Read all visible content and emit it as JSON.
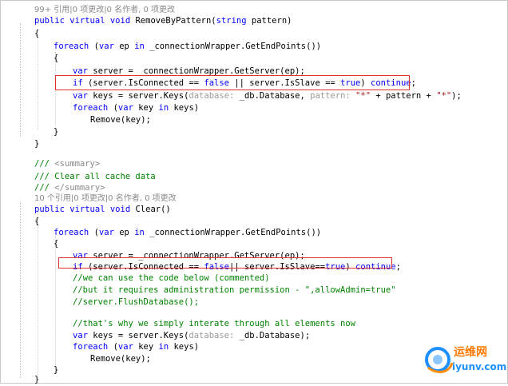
{
  "block1": {
    "lens": "99+ 引用|0 项更改|0 名作者, 0 项更改",
    "sig": {
      "kw1": "public",
      "kw2": "virtual",
      "kw3": "void",
      "name": " RemoveByPattern(",
      "kw4": "string",
      "tail": " pattern)"
    },
    "open1": "{",
    "foreach": {
      "kw": "foreach",
      "a": " (",
      "kw2": "var",
      "b": " ep ",
      "kw3": "in",
      "c": " _connectionWrapper.GetEndPoints())"
    },
    "open2": "{",
    "server": {
      "kw": "var",
      "rest": " server = _connectionWrapper.GetServer(ep);"
    },
    "ifline": {
      "kw": "if",
      "a": " (server.IsConnected == ",
      "kw2": "false",
      "b": " || server.IsSlave == ",
      "kw3": "true",
      "c": ") ",
      "kw4": "continue",
      "d": ";"
    },
    "keys": {
      "kw": "var",
      "a": " keys = server.Keys(",
      "h1": "database:",
      "b": " _db.Database, ",
      "h2": "pattern:",
      "c": " ",
      "s1": "\"*\"",
      "d": " + pattern + ",
      "s2": "\"*\"",
      "e": ");"
    },
    "foreach2": {
      "kw": "foreach",
      "a": " (",
      "kw2": "var",
      "b": " key ",
      "kw3": "in",
      "c": " keys)"
    },
    "remove": "Remove(key);",
    "close2": "}",
    "close1": "}"
  },
  "block2": {
    "sum1": "/// ",
    "sum1tag": "<summary>",
    "sum2": "/// Clear all cache data",
    "sum3": "/// ",
    "sum3tag": "</summary>",
    "lens": "10 个引用|0 项更改|0 名作者, 0 项更改",
    "sig": {
      "kw1": "public",
      "kw2": "virtual",
      "kw3": "void",
      "name": " Clear()"
    },
    "open1": "{",
    "foreach": {
      "kw": "foreach",
      "a": " (",
      "kw2": "var",
      "b": " ep ",
      "kw3": "in",
      "c": " _connectionWrapper.GetEndPoints())"
    },
    "open2": "{",
    "server": {
      "kw": "var",
      "rest": " server = _connectionWrapper.GetServer(ep);"
    },
    "ifline": {
      "kw": "if",
      "a": " (server.IsConnected == ",
      "kw2": "false",
      "b": "|| server.IsSlave==",
      "kw3": "true",
      "c": ") ",
      "kw4": "continue",
      "d": ";"
    },
    "c1": "//we can use the code below (commented)",
    "c2": "//but it requires administration permission - \",allowAdmin=true\"",
    "c3": "//server.FlushDatabase();",
    "c4": "//that's why we simply interate through all elements now",
    "keys": {
      "kw": "var",
      "a": " keys = server.Keys(",
      "h1": "database:",
      "b": " _db.Database);"
    },
    "foreach2": {
      "kw": "foreach",
      "a": " (",
      "kw2": "var",
      "b": " key ",
      "kw3": "in",
      "c": " keys)"
    },
    "remove": "Remove(key);",
    "close2": "}",
    "close1": "}"
  },
  "watermark": {
    "cn": "运维网",
    "en": "iyunv.com"
  },
  "colors": {
    "keyword": "#0000ff",
    "comment": "#008000",
    "string": "#a31515",
    "highlight": "#e03030"
  }
}
